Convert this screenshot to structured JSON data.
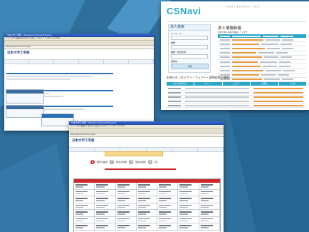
{
  "csnavi": {
    "logo": "CSNavi",
    "top_links": "トップ ｜ サイトマップ ｜ ヘルプ",
    "search_panel": {
      "title": "求人検索",
      "fields": [
        "キーワード",
        "業種",
        "職種・雇用形態",
        "勤務地"
      ],
      "button": "検索"
    },
    "job_list": {
      "title": "求人情報新着",
      "subtitle": "最新の求人情報を掲載しています"
    },
    "notice": {
      "title": "お知らせ（セミナー・フェアー・説明会等の情報）",
      "tabs": [
        "全ての情報を見る",
        "セミナー",
        "フェアー",
        "説明会",
        "その他"
      ]
    }
  },
  "win1": {
    "title": "日本大学工学部 - Windows Internet Explorer",
    "menu": "ファイル(F) 編集(E) 表示(V) お気に入り(A) ツール(T) ヘルプ(H)",
    "address": "http://portal.ce.nihon-u.ac.jp/",
    "logo": "日本大学工学部"
  },
  "win2": {
    "title": "日本大学工学部 - Windows Internet Explorer",
    "menu": "ファイル(F) 編集(E) 表示(V) お気に入り(A) ツール(T) ヘルプ(H)",
    "address": "http://portal.ce.nihon-u.ac.jp/",
    "logo": "日本大学工学部",
    "steps": [
      {
        "num": "1",
        "label": "履修の確認"
      },
      {
        "num": "2",
        "label": "科目の登録"
      },
      {
        "num": "3",
        "label": "登録の確認"
      },
      {
        "num": "4",
        "label": "完了"
      }
    ]
  }
}
